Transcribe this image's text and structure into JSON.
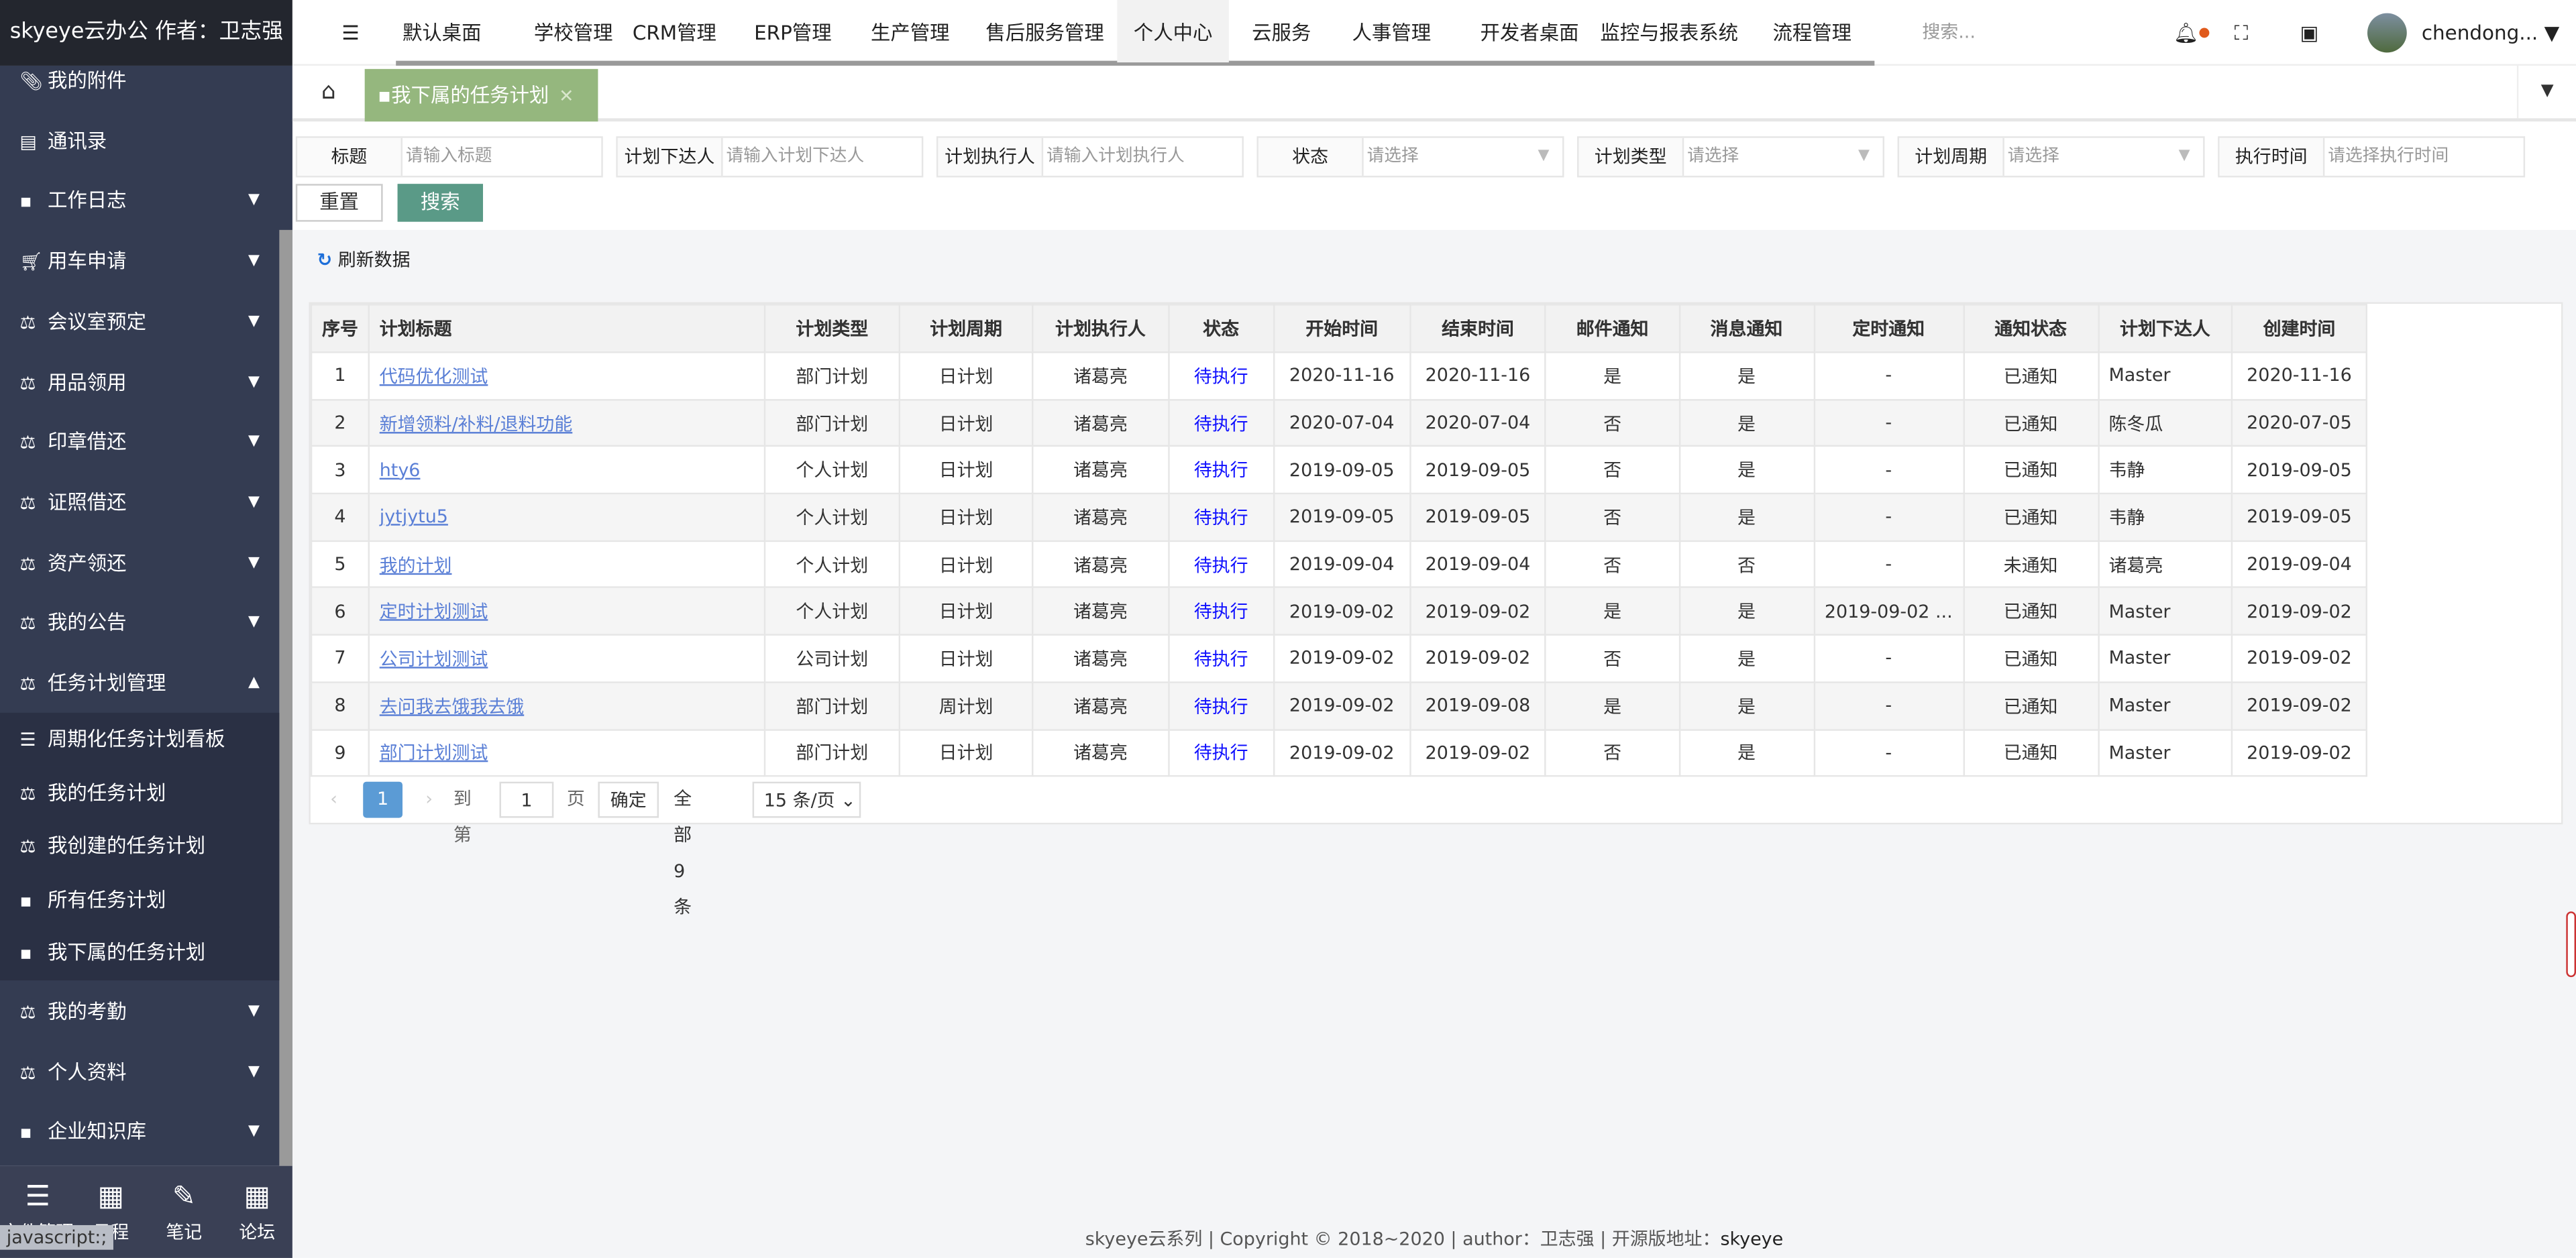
{
  "brand": "skyeye云办公 作者：卫志强",
  "sidebar": {
    "items": [
      {
        "label": "我的附件",
        "icon": "paperclip-folder-icon",
        "arrow": ""
      },
      {
        "label": "通讯录",
        "icon": "address-book-icon",
        "arrow": ""
      },
      {
        "label": "工作日志",
        "icon": "archive-icon",
        "arrow": "▼"
      },
      {
        "label": "用车申请",
        "icon": "cart-icon",
        "arrow": "▼"
      },
      {
        "label": "会议室预定",
        "icon": "balance-icon",
        "arrow": "▼"
      },
      {
        "label": "用品领用",
        "icon": "balance-icon",
        "arrow": "▼"
      },
      {
        "label": "印章借还",
        "icon": "balance-icon",
        "arrow": "▼"
      },
      {
        "label": "证照借还",
        "icon": "balance-icon",
        "arrow": "▼"
      },
      {
        "label": "资产领还",
        "icon": "balance-icon",
        "arrow": "▼"
      },
      {
        "label": "我的公告",
        "icon": "balance-icon",
        "arrow": "▼"
      },
      {
        "label": "任务计划管理",
        "icon": "balance-icon",
        "arrow": "▲"
      }
    ],
    "sub_items": [
      {
        "label": "周期化任务计划看板",
        "icon": "list-icon"
      },
      {
        "label": "我的任务计划",
        "icon": "balance-icon"
      },
      {
        "label": "我创建的任务计划",
        "icon": "balance-icon"
      },
      {
        "label": "所有任务计划",
        "icon": "archive-icon"
      },
      {
        "label": "我下属的任务计划",
        "icon": "archive-icon"
      }
    ],
    "after_items": [
      {
        "label": "我的考勤",
        "icon": "balance-icon",
        "arrow": "▼"
      },
      {
        "label": "个人资料",
        "icon": "balance-icon",
        "arrow": "▼"
      },
      {
        "label": "企业知识库",
        "icon": "archive-icon",
        "arrow": "▼"
      }
    ],
    "bottom": [
      {
        "label": "文件管理",
        "icon": "list-icon"
      },
      {
        "label": "日程",
        "icon": "calendar-icon"
      },
      {
        "label": "笔记",
        "icon": "edit-icon"
      },
      {
        "label": "论坛",
        "icon": "calendar-icon"
      }
    ]
  },
  "status_bar": "javascript:;",
  "topnav": {
    "items": [
      "默认桌面",
      "学校管理",
      "CRM管理",
      "ERP管理",
      "生产管理",
      "售后服务管理",
      "个人中心",
      "云服务",
      "人事管理",
      "开发者桌面",
      "监控与报表系统",
      "流程管理"
    ],
    "active": "个人中心",
    "search_placeholder": "搜索...",
    "user": "chendong..."
  },
  "tabs": {
    "active": "我下属的任务计划"
  },
  "filters": [
    {
      "label": "标题",
      "placeholder": "请输入标题",
      "select": false
    },
    {
      "label": "计划下达人",
      "placeholder": "请输入计划下达人",
      "select": false
    },
    {
      "label": "计划执行人",
      "placeholder": "请输入计划执行人",
      "select": false
    },
    {
      "label": "状态",
      "placeholder": "请选择",
      "select": true
    },
    {
      "label": "计划类型",
      "placeholder": "请选择",
      "select": true
    },
    {
      "label": "计划周期",
      "placeholder": "请选择",
      "select": true
    },
    {
      "label": "执行时间",
      "placeholder": "请选择执行时间",
      "select": false
    }
  ],
  "buttons": {
    "reset": "重置",
    "search": "搜索",
    "refresh": "刷新数据"
  },
  "colors": {
    "accent": "#95b77e",
    "search_btn": "#5a9a87",
    "sidebar": "#343c52",
    "link": "#5a7fd6",
    "status": "#1010ff"
  },
  "table": {
    "headers": [
      "序号",
      "计划标题",
      "计划类型",
      "计划周期",
      "计划执行人",
      "状态",
      "开始时间",
      "结束时间",
      "邮件通知",
      "消息通知",
      "定时通知",
      "通知状态",
      "计划下达人",
      "创建时间"
    ],
    "rows": [
      [
        "1",
        "代码优化测试",
        "部门计划",
        "日计划",
        "诸葛亮",
        "待执行",
        "2020-11-16",
        "2020-11-16",
        "是",
        "是",
        "-",
        "已通知",
        "Master",
        "2020-11-16"
      ],
      [
        "2",
        "新增领料/补料/退料功能",
        "部门计划",
        "日计划",
        "诸葛亮",
        "待执行",
        "2020-07-04",
        "2020-07-04",
        "否",
        "是",
        "-",
        "已通知",
        "陈冬瓜",
        "2020-07-05"
      ],
      [
        "3",
        "hty6",
        "个人计划",
        "日计划",
        "诸葛亮",
        "待执行",
        "2019-09-05",
        "2019-09-05",
        "否",
        "是",
        "-",
        "已通知",
        "韦静",
        "2019-09-05"
      ],
      [
        "4",
        "jytjytu5",
        "个人计划",
        "日计划",
        "诸葛亮",
        "待执行",
        "2019-09-05",
        "2019-09-05",
        "否",
        "是",
        "-",
        "已通知",
        "韦静",
        "2019-09-05"
      ],
      [
        "5",
        "我的计划",
        "个人计划",
        "日计划",
        "诸葛亮",
        "待执行",
        "2019-09-04",
        "2019-09-04",
        "否",
        "否",
        "-",
        "未通知",
        "诸葛亮",
        "2019-09-04"
      ],
      [
        "6",
        "定时计划测试",
        "个人计划",
        "日计划",
        "诸葛亮",
        "待执行",
        "2019-09-02",
        "2019-09-02",
        "是",
        "是",
        "2019-09-02 ...",
        "已通知",
        "Master",
        "2019-09-02"
      ],
      [
        "7",
        "公司计划测试",
        "公司计划",
        "日计划",
        "诸葛亮",
        "待执行",
        "2019-09-02",
        "2019-09-02",
        "否",
        "是",
        "-",
        "已通知",
        "Master",
        "2019-09-02"
      ],
      [
        "8",
        "去问我去饿我去饿",
        "部门计划",
        "周计划",
        "诸葛亮",
        "待执行",
        "2019-09-02",
        "2019-09-08",
        "是",
        "是",
        "-",
        "已通知",
        "Master",
        "2019-09-02"
      ],
      [
        "9",
        "部门计划测试",
        "部门计划",
        "日计划",
        "诸葛亮",
        "待执行",
        "2019-09-02",
        "2019-09-02",
        "否",
        "是",
        "-",
        "已通知",
        "Master",
        "2019-09-02"
      ]
    ]
  },
  "pager": {
    "current": "1",
    "goto_label": "到第",
    "page_input": "1",
    "page_unit": "页",
    "confirm": "确定",
    "total": "全部 9 条",
    "page_size": "15 条/页"
  },
  "footer": {
    "text": "skyeye云系列 | Copyright © 2018~2020 | author：卫志强 | 开源版地址：",
    "link": "skyeye"
  }
}
